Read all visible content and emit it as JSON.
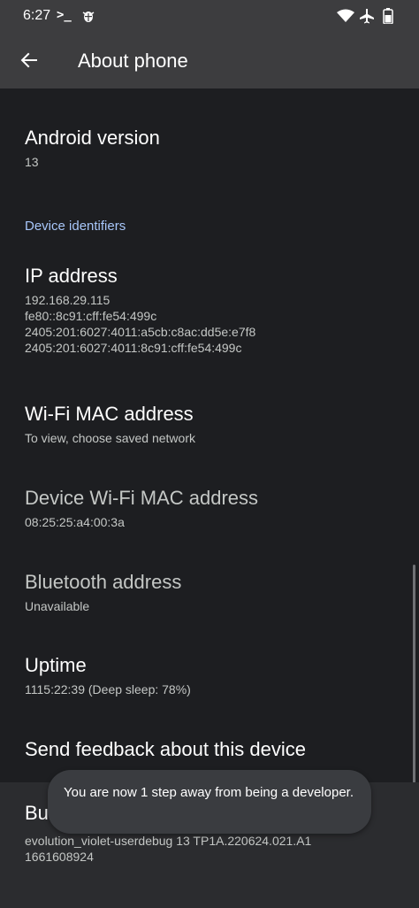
{
  "status_bar": {
    "time": "6:27",
    "terminal_icon": "terminal-icon",
    "bug_icon": "bug-icon",
    "wifi_icon": "wifi-icon",
    "airplane_icon": "airplane-icon",
    "battery_icon": "battery-icon"
  },
  "app_bar": {
    "title": "About phone",
    "back_icon": "arrow-back-icon"
  },
  "prefs": {
    "android_version": {
      "title": "Android version",
      "summary": "13"
    },
    "section_header": "Device identifiers",
    "ip_address": {
      "title": "IP address",
      "lines": [
        "192.168.29.115",
        "fe80::8c91:cff:fe54:499c",
        "2405:201:6027:4011:a5cb:c8ac:dd5e:e7f8",
        "2405:201:6027:4011:8c91:cff:fe54:499c"
      ]
    },
    "wifi_mac": {
      "title": "Wi-Fi MAC address",
      "summary": "To view, choose saved network"
    },
    "device_wifi_mac": {
      "title": "Device Wi-Fi MAC address",
      "summary": "08:25:25:a4:00:3a"
    },
    "bluetooth": {
      "title": "Bluetooth address",
      "summary": "Unavailable"
    },
    "uptime": {
      "title": "Uptime",
      "summary": "1115:22:39 (Deep sleep: 78%)"
    },
    "feedback": {
      "title": "Send feedback about this device"
    },
    "build": {
      "title": "Bu",
      "lines": [
        "evolution_violet-userdebug 13 TP1A.220624.021.A1",
        "1661608924"
      ]
    }
  },
  "toast": {
    "text": "You are now 1 step away from being a developer."
  },
  "colors": {
    "background": "#1d1e21",
    "app_bar": "#3d3d3f",
    "accent": "#a8c7fa",
    "toast": "#3a3c40"
  }
}
